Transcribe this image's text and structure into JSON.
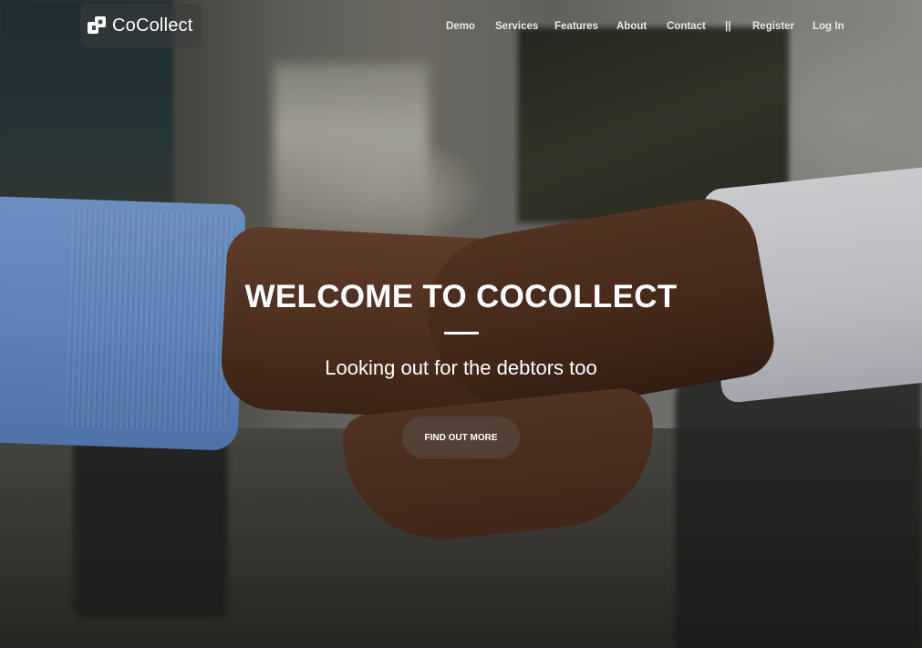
{
  "brand": {
    "name": "CoCollect",
    "icon": "cocollect-logo-icon"
  },
  "nav": {
    "items": [
      {
        "label": "Demo"
      },
      {
        "label": "Services"
      },
      {
        "label": "Features"
      },
      {
        "label": "About"
      },
      {
        "label": "Contact"
      },
      {
        "label": "||"
      },
      {
        "label": "Register"
      },
      {
        "label": "Log In"
      }
    ]
  },
  "hero": {
    "title": "WELCOME TO COCOLLECT",
    "subtitle": "Looking out for the debtors too",
    "cta_label": "FIND OUT MORE"
  },
  "colors": {
    "text": "#ffffff",
    "nav_text": "#e9e9e9"
  }
}
